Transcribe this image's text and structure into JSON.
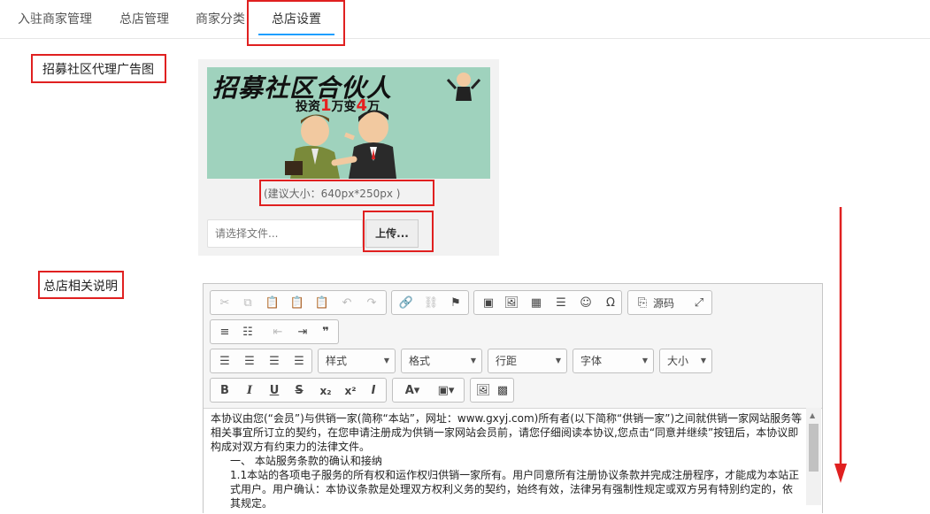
{
  "tabs": [
    {
      "label": "入驻商家管理"
    },
    {
      "label": "总店管理"
    },
    {
      "label": "商家分类"
    },
    {
      "label": "总店设置",
      "active": true
    }
  ],
  "ad_section": {
    "label": "招募社区代理广告图",
    "banner_title": "招募社区合伙人",
    "banner_sub_prefix": "投资",
    "banner_sub_num1": "1",
    "banner_sub_mid": "万变",
    "banner_sub_num2": "4",
    "banner_sub_suffix": "万",
    "size_hint": "(建议大小：640px*250px )",
    "file_placeholder": "请选择文件...",
    "upload_label": "上传..."
  },
  "desc_section": {
    "label": "总店相关说明",
    "toolbar": {
      "source_label": "源码",
      "style_combo": "样式",
      "format_combo": "格式",
      "line_height_combo": "行距",
      "font_combo": "字体",
      "size_combo": "大小"
    },
    "content": [
      "本协议由您(“会员”)与供销一家(简称“本站”，网址：www.gxyj.com)所有者(以下简称“供销一家”)之间就供销一家网站服务等相关事宜所订立的契约，在您申请注册成为供销一家网站会员前，请您仔细阅读本协议,您点击“同意并继续”按钮后，本协议即构成对双方有约束力的法律文件。",
      "一、 本站服务条款的确认和接纳",
      "1.1本站的各项电子服务的所有权和运作权归供销一家所有。用户同意所有注册协议条款并完成注册程序，才能成为本站正式用户。用户确认：本协议条款是处理双方权利义务的契约，始终有效，法律另有强制性规定或双方另有特别约定的，依其规定。"
    ]
  },
  "colors": {
    "accent": "#1e9fff",
    "highlight": "#e02020",
    "banner_bg": "#9fd2bd"
  }
}
